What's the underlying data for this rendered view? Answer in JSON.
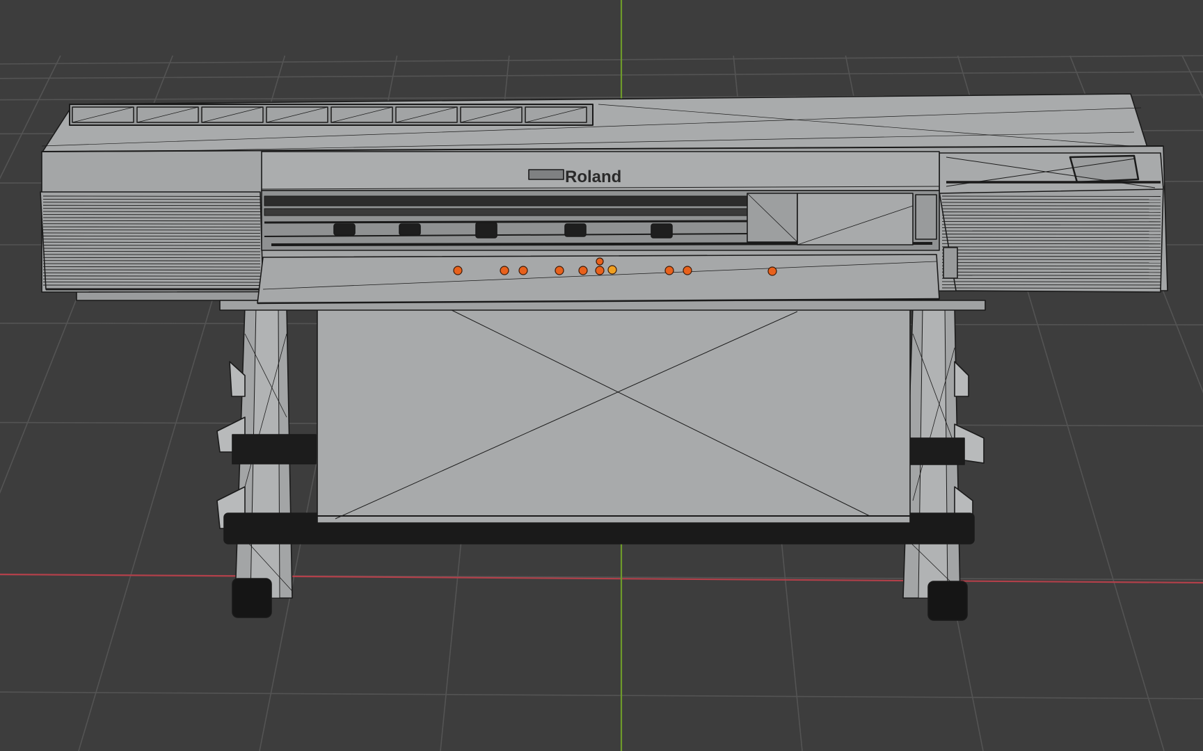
{
  "viewport": {
    "background": "#3d3d3d",
    "grid_color": "#545454",
    "x_axis_color": "#b3404a",
    "y_axis_color": "#6e9a2a"
  },
  "model": {
    "logo_text": "Roland",
    "body_color": "#a6a8a9",
    "edge_color": "#1a1a1a",
    "selected_vertex_color": "#e8611c",
    "active_vertex_color": "#f0a020"
  }
}
